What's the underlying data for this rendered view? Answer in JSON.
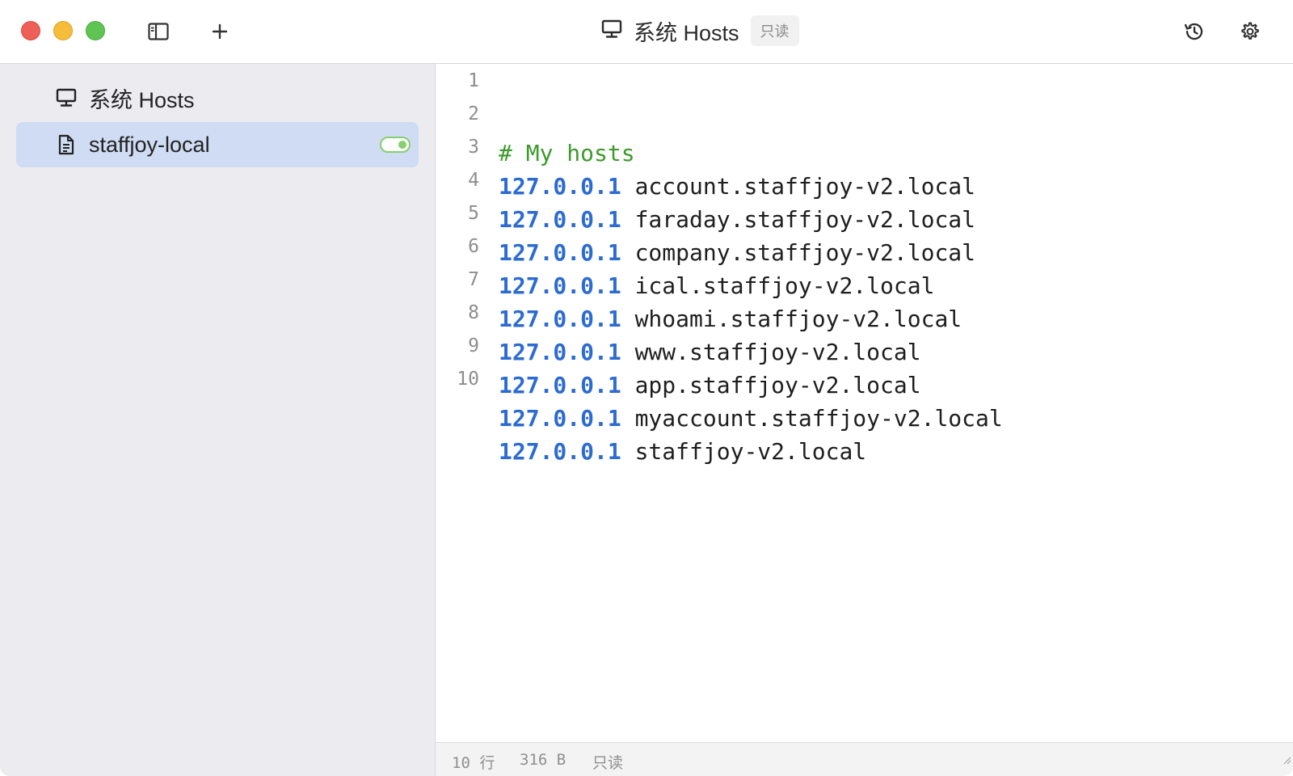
{
  "titlebar": {
    "title_icon": "monitor-icon",
    "title": "系统 Hosts",
    "readonly_badge": "只读",
    "buttons": {
      "sidebar_toggle_icon": "sidebar-toggle-icon",
      "add_icon": "plus-icon",
      "history_icon": "history-icon",
      "settings_icon": "gear-icon"
    }
  },
  "sidebar": {
    "items": [
      {
        "label": "系统 Hosts",
        "icon": "monitor-icon",
        "active": false
      },
      {
        "label": "staffjoy-local",
        "icon": "document-icon",
        "active": true,
        "enabled": true
      }
    ]
  },
  "editor": {
    "lines": [
      {
        "num": "1",
        "comment": "# My hosts"
      },
      {
        "num": "2",
        "ip": "127.0.0.1",
        "host": "account.staffjoy-v2.local"
      },
      {
        "num": "3",
        "ip": "127.0.0.1",
        "host": "faraday.staffjoy-v2.local"
      },
      {
        "num": "4",
        "ip": "127.0.0.1",
        "host": "company.staffjoy-v2.local"
      },
      {
        "num": "5",
        "ip": "127.0.0.1",
        "host": "ical.staffjoy-v2.local"
      },
      {
        "num": "6",
        "ip": "127.0.0.1",
        "host": "whoami.staffjoy-v2.local"
      },
      {
        "num": "7",
        "ip": "127.0.0.1",
        "host": "www.staffjoy-v2.local"
      },
      {
        "num": "8",
        "ip": "127.0.0.1",
        "host": "app.staffjoy-v2.local"
      },
      {
        "num": "9",
        "ip": "127.0.0.1",
        "host": "myaccount.staffjoy-v2.local"
      },
      {
        "num": "10",
        "ip": "127.0.0.1",
        "host": "staffjoy-v2.local"
      }
    ]
  },
  "statusbar": {
    "lines": "10 行",
    "size": "316 B",
    "mode": "只读"
  },
  "colors": {
    "ip": "#2c6bd1",
    "comment": "#3d9a2c",
    "active_item": "#cfdcf3",
    "toggle_on": "#86cf6f"
  }
}
